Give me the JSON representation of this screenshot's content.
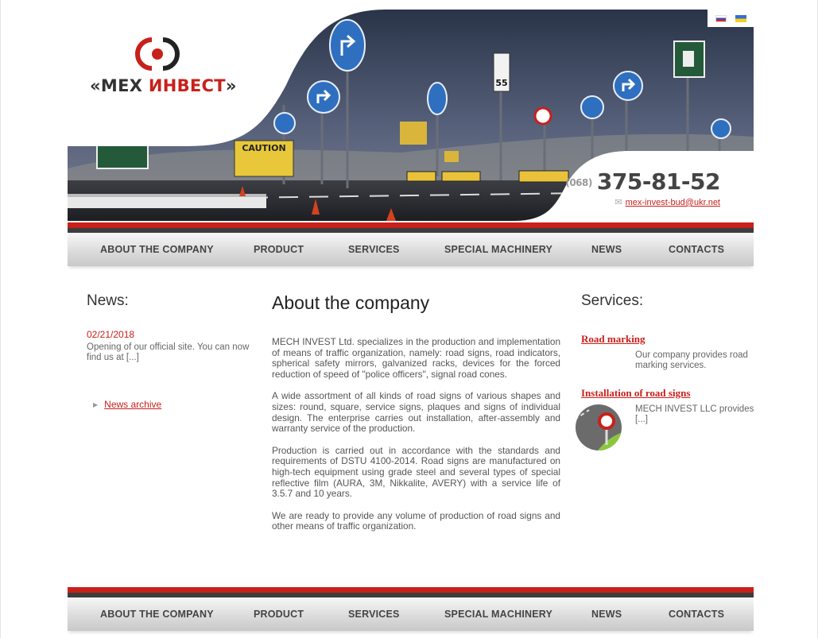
{
  "header": {
    "logo_prefix": "«МЕХ ",
    "logo_accent": "ИНВЕСТ",
    "logo_suffix": "»",
    "phone_code": "(068)",
    "phone_number": "375-81-52",
    "email": "mex-invest-bud@ukr.net",
    "flags": [
      "ru",
      "ua"
    ]
  },
  "nav": [
    "ABOUT THE COMPANY",
    "PRODUCT",
    "SERVICES",
    "SPECIAL MACHINERY",
    "NEWS",
    "CONTACTS"
  ],
  "news": {
    "title": "News:",
    "date": "02/21/2018",
    "text": "Opening of our official site. You can now find us at [...]",
    "archive_label": "News archive"
  },
  "main": {
    "title": "About the company",
    "paragraphs": [
      "MECH INVEST Ltd. specializes in the production and implementation of means of traffic organization, namely: road signs, road indicators, spherical safety mirrors, galvanized racks, devices for the forced reduction of speed of \"police officers\", signal road cones.",
      "A wide assortment of all kinds of road signs of various shapes and sizes: round, square, service signs, plaques and signs of individual design. The enterprise carries out installation, after-assembly and warranty service of the production.",
      "Production is carried out in accordance with the standards and requirements of DSTU 4100-2014. Road signs are manufactured on high-tech equipment using grade steel and several types of special reflective film (AURA, 3M, Nikkalite, AVERY) with a service life of 3.5.7 and 10 years.",
      "We are ready to provide any volume of production of road signs and other means of traffic organization."
    ]
  },
  "services": {
    "title": "Services:",
    "items": [
      {
        "title": "Road marking",
        "text": "Our company provides road marking services."
      },
      {
        "title": "Installation of road signs",
        "text": "MECH INVEST LLC provides [...]"
      }
    ]
  },
  "colors": {
    "accent": "#c8201b",
    "dark_strip": "#3d3d3d"
  }
}
